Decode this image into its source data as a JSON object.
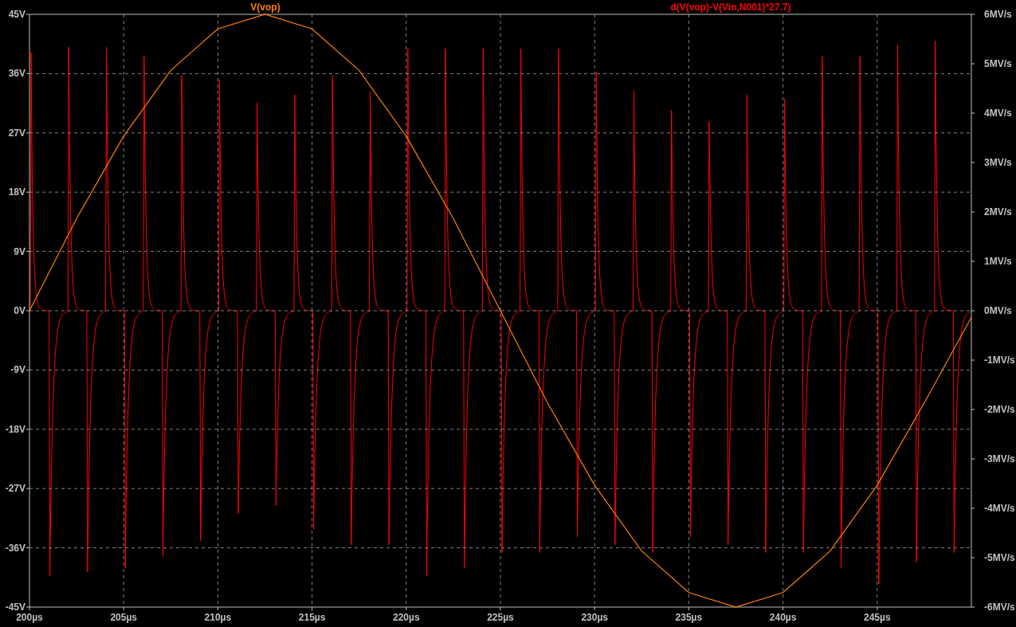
{
  "plot": {
    "derivative_trace": {
      "label": "d(V(vop)-V(Vin,N001)*27.7)",
      "color": "#ff0000"
    },
    "right_axis": {
      "ticks": [
        "6MV/s",
        "5MV/s",
        "4MV/s",
        "3MV/s",
        "2MV/s",
        "1MV/s",
        "0MV/s",
        "-1MV/s",
        "-2MV/s",
        "-3MV/s",
        "-4MV/s",
        "-5MV/s",
        "-6MV/s"
      ]
    },
    "chart_data": {
      "type": "line",
      "x": [
        200,
        202.5,
        205,
        207.5,
        210,
        212.5,
        215,
        217.5,
        220,
        222.5,
        225,
        227.5,
        230,
        232.5,
        235,
        237.5,
        240,
        242.5,
        245,
        247.5,
        250
      ],
      "series": [
        {
          "name": "V(vop)",
          "color": "#ff8000",
          "values": [
            0,
            14,
            26.5,
            36.5,
            42.8,
            45,
            42.8,
            36.5,
            26.5,
            14,
            0,
            -14,
            -26.5,
            -36.5,
            -42.8,
            -45,
            -42.8,
            -36.5,
            -26.5,
            -14,
            -1
          ]
        }
      ],
      "xlim": [
        200,
        250
      ],
      "ylim": [
        -45,
        45
      ],
      "grid": true,
      "xticks": [
        {
          "value": 200,
          "label": "200µs"
        },
        {
          "value": 205,
          "label": "205µs"
        },
        {
          "value": 210,
          "label": "210µs"
        },
        {
          "value": 215,
          "label": "215µs"
        },
        {
          "value": 220,
          "label": "220µs"
        },
        {
          "value": 225,
          "label": "225µs"
        },
        {
          "value": 230,
          "label": "230µs"
        },
        {
          "value": 235,
          "label": "235µs"
        },
        {
          "value": 240,
          "label": "240µs"
        },
        {
          "value": 245,
          "label": "245µs"
        }
      ],
      "yticks": [
        {
          "value": 45,
          "label": "45V"
        },
        {
          "value": 36,
          "label": "36V"
        },
        {
          "value": 27,
          "label": "27V"
        },
        {
          "value": 18,
          "label": "18V"
        },
        {
          "value": 9,
          "label": "9V"
        },
        {
          "value": 0,
          "label": "0V"
        },
        {
          "value": -9,
          "label": "-9V"
        },
        {
          "value": -18,
          "label": "-18V"
        },
        {
          "value": -27,
          "label": "-27V"
        },
        {
          "value": -36,
          "label": "-36V"
        },
        {
          "value": -45,
          "label": "-45V"
        }
      ]
    }
  }
}
